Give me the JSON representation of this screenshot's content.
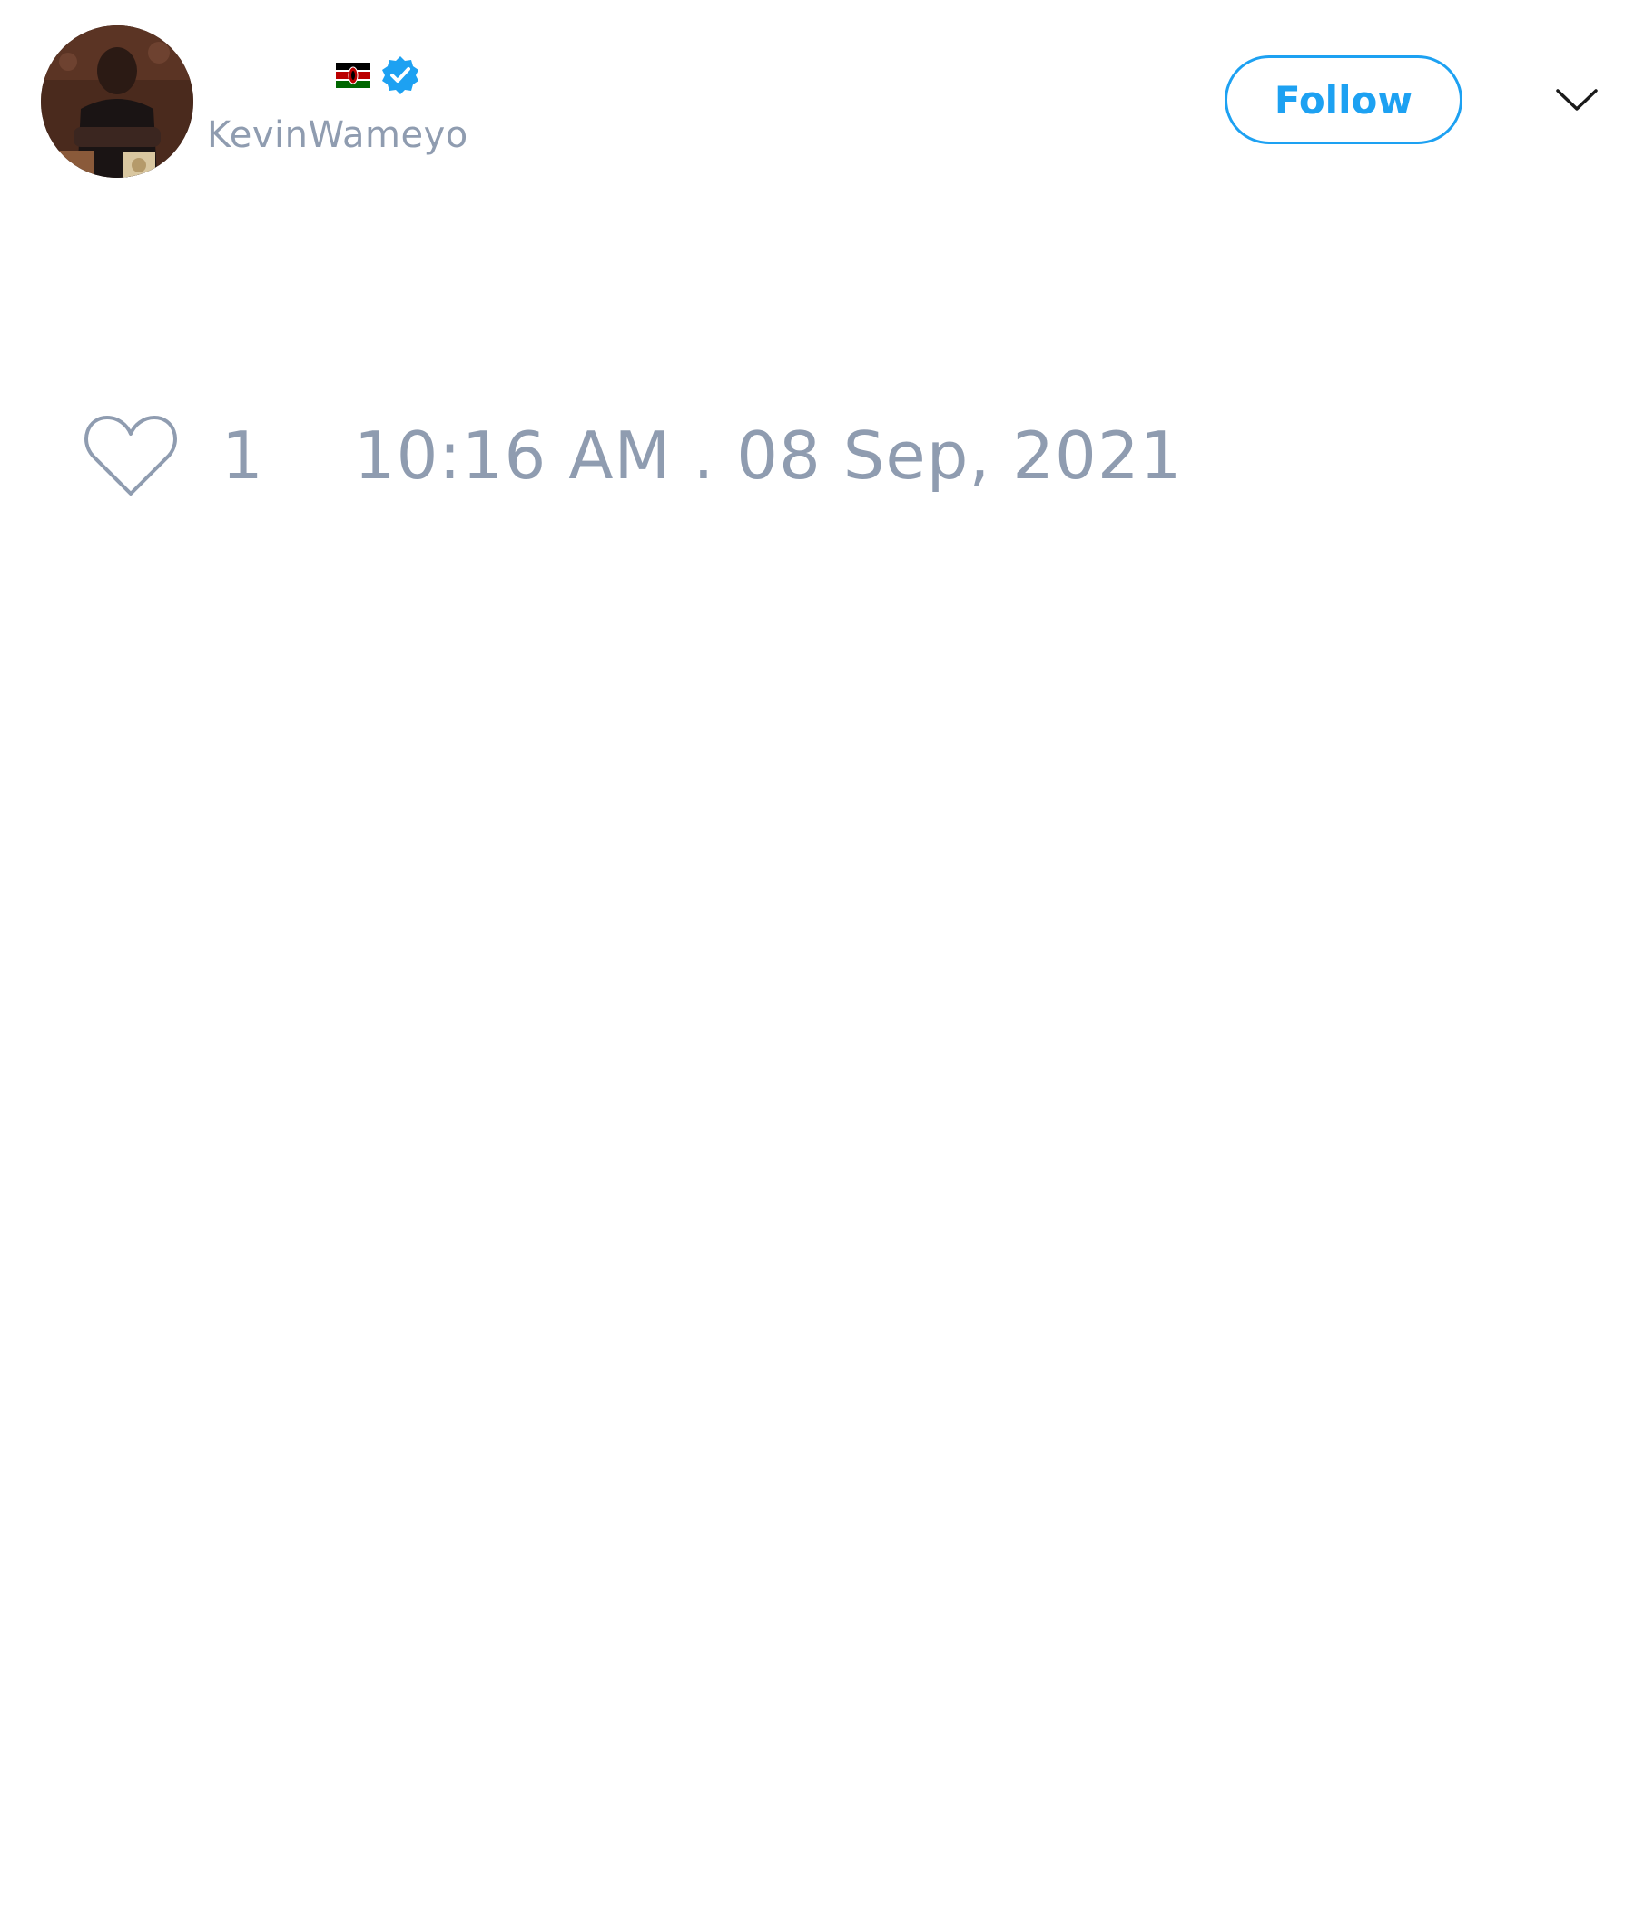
{
  "tweet": {
    "author": {
      "handle": "KevinWameyo",
      "avatar_icon": "profile-photo",
      "flag_icon": "kenya-flag-icon",
      "verified_icon": "verified-badge-icon"
    },
    "follow_label": "Follow",
    "menu_icon": "chevron-down-icon",
    "like_icon": "heart-icon",
    "like_count": "1",
    "timestamp": "10:16 AM . 08 Sep, 2021"
  },
  "colors": {
    "accent": "#1da1f2",
    "muted_text": "#8f9cb0",
    "background": "#ffffff"
  }
}
